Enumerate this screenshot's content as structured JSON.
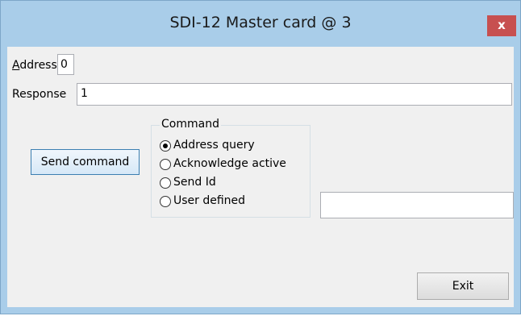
{
  "window": {
    "title": "SDI-12 Master card @ 3",
    "close_label": "x"
  },
  "form": {
    "address_label_first": "A",
    "address_label_rest": "ddress",
    "address_value": "0",
    "response_label": "Response",
    "response_value": "1",
    "send_button_label": "Send command",
    "user_defined_value": "",
    "exit_button_label": "Exit"
  },
  "command_group": {
    "title": "Command",
    "selected": "Address query",
    "options": [
      {
        "label": "Address query",
        "checked": true
      },
      {
        "label": "Acknowledge active",
        "checked": false
      },
      {
        "label": "Send Id",
        "checked": false
      },
      {
        "label": "User defined",
        "checked": false
      }
    ]
  },
  "colors": {
    "frame": "#a9cde9",
    "client": "#f0f0f0",
    "close_button": "#c75050",
    "button_border_focus": "#3c7fb1"
  }
}
